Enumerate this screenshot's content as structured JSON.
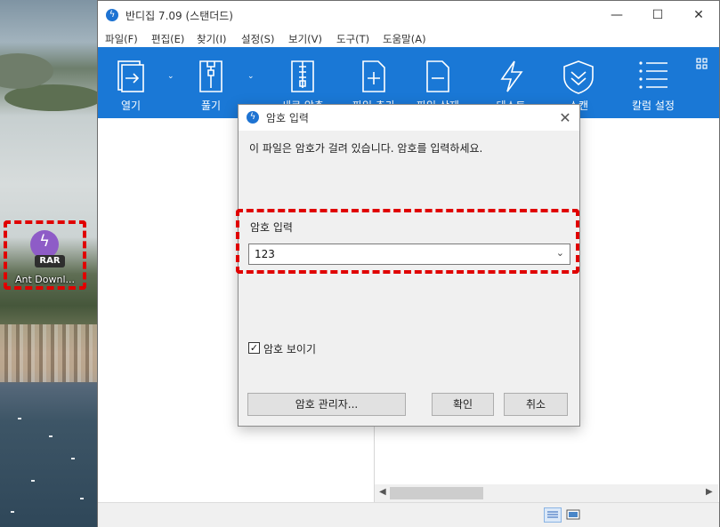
{
  "desktop": {
    "icon_label": "Ant Downl...",
    "icon_badge": "RAR",
    "icon_name": "rar-file-icon"
  },
  "app": {
    "title": "반디집 7.09 (스탠더드)",
    "window_controls": {
      "minimize": "—",
      "maximize": "☐",
      "close": "✕"
    },
    "menu": [
      "파일(F)",
      "편집(E)",
      "찾기(I)",
      "설정(S)",
      "보기(V)",
      "도구(T)",
      "도움말(A)"
    ],
    "toolbar": [
      {
        "label": "열기",
        "icon": "open-archive-icon"
      },
      {
        "label": "풀기",
        "icon": "extract-icon"
      },
      {
        "label": "새로 압축",
        "icon": "new-archive-icon"
      },
      {
        "label": "파일 추가",
        "icon": "add-file-icon"
      },
      {
        "label": "파일 삭제",
        "icon": "delete-file-icon"
      },
      {
        "label": "테스트",
        "icon": "test-icon"
      },
      {
        "label": "스캔",
        "icon": "scan-icon"
      },
      {
        "label": "칼럼 설정",
        "icon": "column-settings-icon"
      }
    ],
    "accent_color": "#1a78d6"
  },
  "dialog": {
    "title": "암호 입력",
    "message": "이 파일은 암호가 걸려 있습니다. 암호를 입력하세요.",
    "password_label": "암호 입력",
    "password_value": "123",
    "show_password_label": "암호 보이기",
    "show_password_checked": true,
    "manager_button": "암호 관리자...",
    "ok_button": "확인",
    "cancel_button": "취소"
  },
  "highlight_color": "#e00000"
}
